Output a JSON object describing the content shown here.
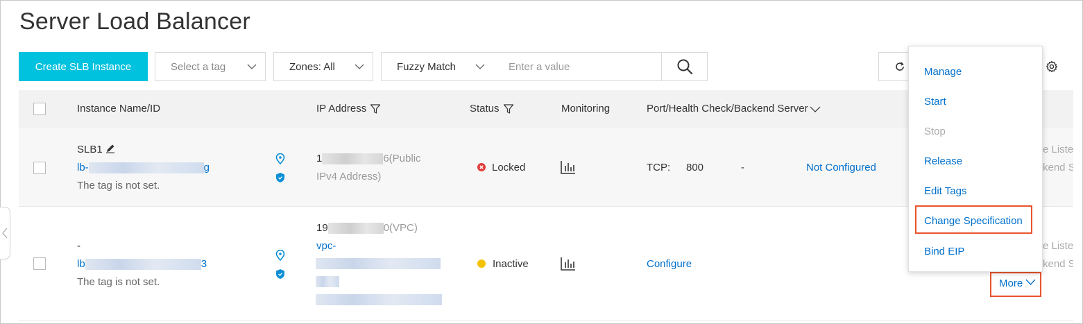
{
  "title": "Server Load Balancer",
  "toolbar": {
    "create_label": "Create SLB Instance",
    "tag_placeholder": "Select a tag",
    "zones_label": "Zones: All",
    "match_label": "Fuzzy Match",
    "search_placeholder": "Enter a value"
  },
  "table": {
    "headers": {
      "name": "Instance Name/ID",
      "ip": "IP Address",
      "status": "Status",
      "monitoring": "Monitoring",
      "port": "Port/Health Check/Backend Server"
    },
    "rows": [
      {
        "name": "SLB1",
        "id_prefix": "lb-",
        "id_suffix": "g",
        "tag": "The tag is not set.",
        "ip_prefix": "1",
        "ip_suffix": "6(Public",
        "ip_type_line2": "IPv4 Address)",
        "status": "Locked",
        "protocol": "TCP:",
        "port": "800",
        "health": "-",
        "backend": "Not Configured",
        "cut_line1": "e Liste",
        "cut_line2": "kend S"
      },
      {
        "name": "-",
        "id_prefix": "lb",
        "id_suffix": "3",
        "tag": "The tag is not set.",
        "ip_prefix": "19",
        "ip_suffix": "0(VPC)",
        "vpc_label": "vpc-",
        "status": "Inactive",
        "configure": "Configure",
        "more": "More",
        "cut_line1": "e Liste",
        "cut_line2": "kend S"
      }
    ]
  },
  "menu": {
    "items": [
      "Manage",
      "Start",
      "Stop",
      "Release",
      "Edit Tags",
      "Change Specification",
      "Bind EIP"
    ]
  },
  "colors": {
    "primary": "#00c1de",
    "link": "#0070cc",
    "locked": "#e23c39",
    "inactive": "#f3c200",
    "highlight": "#e8542e"
  }
}
